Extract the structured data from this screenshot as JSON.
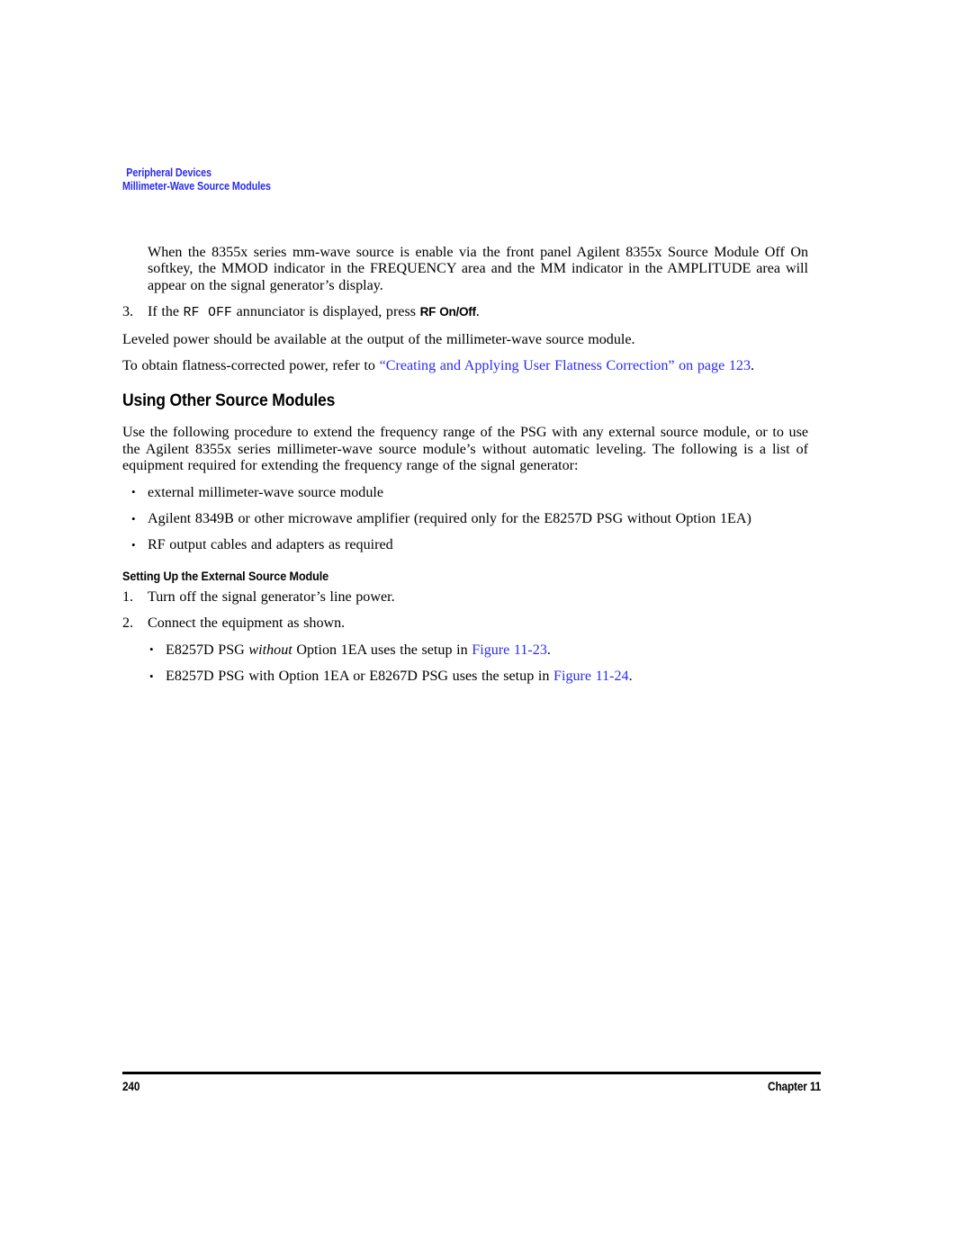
{
  "header": {
    "line1": "Peripheral Devices",
    "line2": "Millimeter-Wave Source Modules"
  },
  "colors": {
    "link": "#2b2bf0",
    "text": "#000000",
    "page_background": "#ffffff"
  },
  "body": {
    "intro_paragraph": "When the 8355x series mm-wave source is enable via the front panel Agilent 8355x Source Module Off On softkey, the MMOD indicator in the FREQUENCY area and the MM indicator in the AMPLITUDE area will appear on the signal generator’s display.",
    "step3": {
      "number": "3.",
      "text_before": "If the ",
      "annunciator": "RF OFF",
      "text_middle": " annunciator is displayed, press ",
      "softkey": "RF On/Off",
      "text_after": "."
    },
    "leveled_power_paragraph": "Leveled power should be available at the output of the millimeter-wave source module.",
    "flatness_paragraph": {
      "text_before": "To obtain flatness-corrected power, refer to ",
      "link_text": "“Creating and Applying User Flatness Correction” on page 123",
      "text_after": "."
    }
  },
  "section": {
    "heading": "Using Other Source Modules",
    "paragraph": "Use the following procedure to extend the frequency range of the PSG with any external source module, or to use the Agilent 8355x series millimeter-wave source module’s without automatic leveling. The following is a list of equipment required for extending the frequency range of the signal generator:",
    "equipment_bullets": [
      "external millimeter-wave source module",
      "Agilent 8349B or other microwave amplifier (required only for the E8257D PSG without Option 1EA)",
      "RF output cables and adapters as required"
    ],
    "bullet_glyph": "•"
  },
  "subsection": {
    "heading": "Setting Up the External Source Module",
    "steps": [
      {
        "number": "1.",
        "text": "Turn off the signal generator’s line power."
      },
      {
        "number": "2.",
        "text": "Connect the equipment as shown."
      }
    ],
    "sub_bullets": [
      {
        "text_before": "E8257D PSG ",
        "italic": "without",
        "text_middle": " Option 1EA uses the setup in ",
        "link_text": "Figure 11-23",
        "text_after": "."
      },
      {
        "text_before": "E8257D PSG with Option 1EA or E8267D PSG uses the setup in ",
        "italic": "",
        "text_middle": "",
        "link_text": "Figure 11-24",
        "text_after": "."
      }
    ]
  },
  "footer": {
    "page_number": "240",
    "chapter": "Chapter 11"
  }
}
